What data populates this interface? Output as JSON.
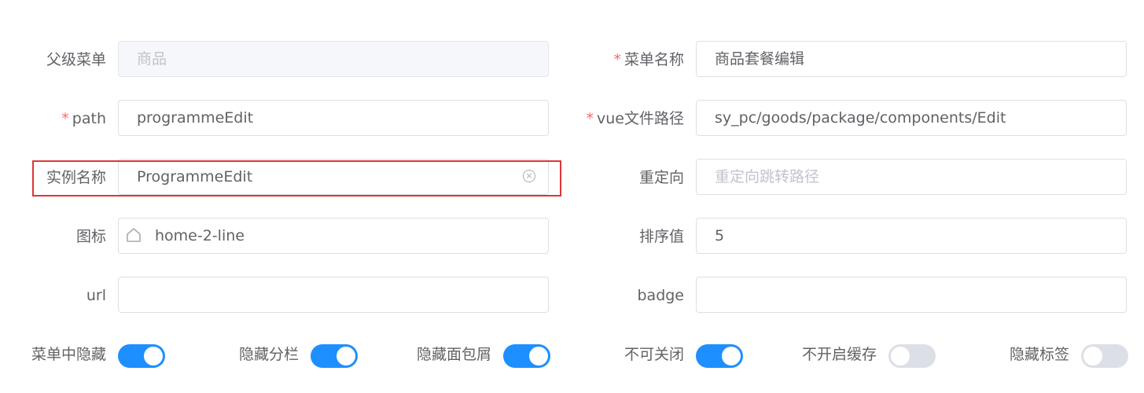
{
  "form": {
    "parent_menu": {
      "label": "父级菜单",
      "value": "商品"
    },
    "menu_name": {
      "required_mark": "*",
      "label": "菜单名称",
      "value": "商品套餐编辑"
    },
    "path": {
      "required_mark": "*",
      "label": "path",
      "value": "programmeEdit"
    },
    "vue_file_path": {
      "required_mark": "*",
      "label": "vue文件路径",
      "value": "sy_pc/goods/package/components/Edit"
    },
    "instance_name": {
      "label": "实例名称",
      "value": "ProgrammeEdit",
      "clear_icon": "circle-close-icon"
    },
    "redirect": {
      "label": "重定向",
      "value": "",
      "placeholder": "重定向跳转路径"
    },
    "icon": {
      "label": "图标",
      "value": "home-2-line",
      "icon": "home-icon"
    },
    "sort": {
      "label": "排序值",
      "value": "5"
    },
    "url": {
      "label": "url",
      "value": ""
    },
    "badge": {
      "label": "badge",
      "value": ""
    }
  },
  "switches": [
    {
      "label": "菜单中隐藏",
      "on": true
    },
    {
      "label": "隐藏分栏",
      "on": true
    },
    {
      "label": "隐藏面包屑",
      "on": true
    },
    {
      "label": "不可关闭",
      "on": true
    },
    {
      "label": "不开启缓存",
      "on": false
    },
    {
      "label": "隐藏标签",
      "on": false
    }
  ],
  "colors": {
    "switch_on": "#1e8fff",
    "switch_off": "#dcdfe6",
    "required": "#f56c6c",
    "highlight_box": "#e03535"
  }
}
